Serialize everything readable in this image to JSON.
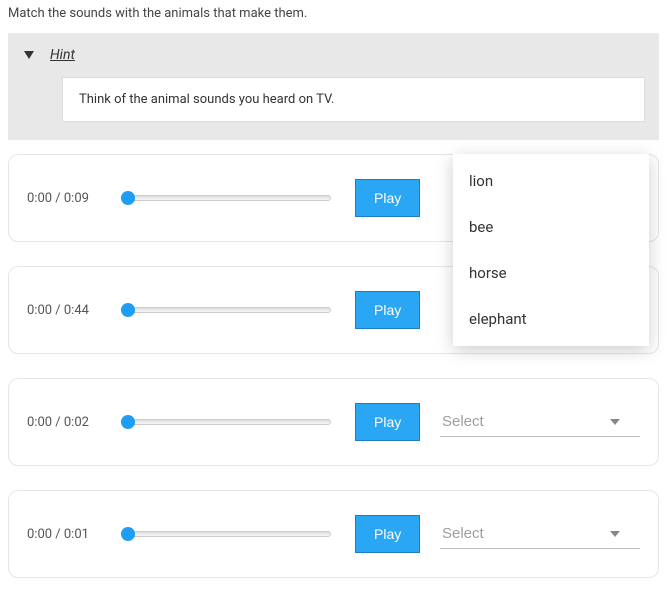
{
  "instruction": "Match the sounds with the animals that make them.",
  "hint": {
    "label": "Hint",
    "body": "Think of the animal sounds you heard on TV."
  },
  "play_label": "Play",
  "select_placeholder": "Select",
  "rows": [
    {
      "time": "0:00 / 0:09"
    },
    {
      "time": "0:00 / 0:44"
    },
    {
      "time": "0:00 / 0:02"
    },
    {
      "time": "0:00 / 0:01"
    }
  ],
  "dropdown_options": [
    "lion",
    "bee",
    "horse",
    "elephant"
  ]
}
